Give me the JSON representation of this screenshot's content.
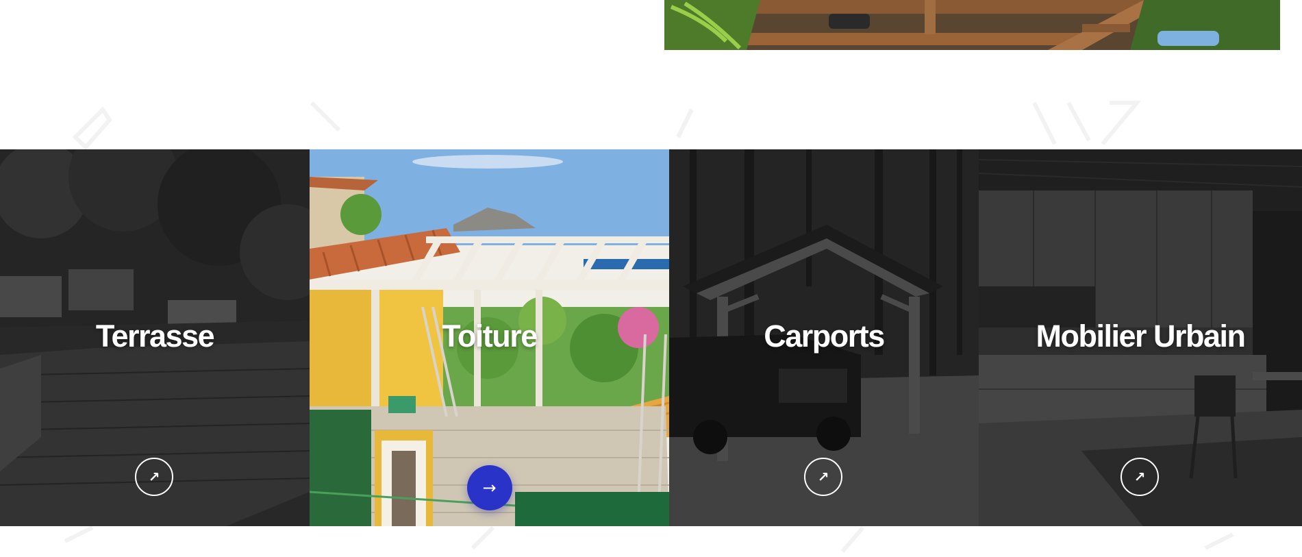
{
  "colors": {
    "accent": "#2a33c8",
    "panel_overlay": "#2b2b2b",
    "text": "#ffffff"
  },
  "services": [
    {
      "title": "Terrasse",
      "arrow_icon": "north-east-arrow-icon",
      "arrow": "↗",
      "active": false
    },
    {
      "title": "Toiture",
      "arrow_icon": "right-arrow-icon",
      "arrow": "→",
      "active": true
    },
    {
      "title": "Carports",
      "arrow_icon": "north-east-arrow-icon",
      "arrow": "↗",
      "active": false
    },
    {
      "title": "Mobilier Urbain",
      "arrow_icon": "north-east-arrow-icon",
      "arrow": "↗",
      "active": false
    }
  ]
}
